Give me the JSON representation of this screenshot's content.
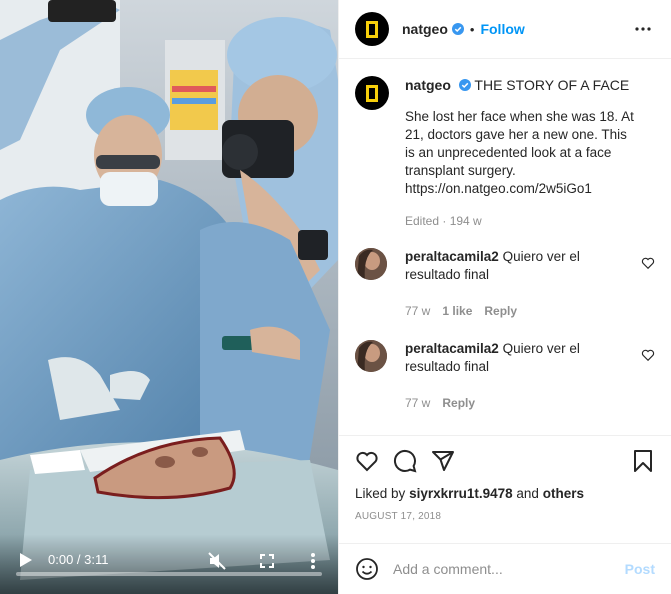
{
  "video": {
    "time": "0:00 / 3:11",
    "progress": 0.0
  },
  "header": {
    "username": "natgeo",
    "separator": "•",
    "follow_label": "Follow"
  },
  "caption": {
    "username": "natgeo",
    "title": "THE STORY OF A FACE",
    "text": "She lost her face when she was 18. At 21, doctors gave her a new one. This is an unprecedented look at a face transplant surgery. https://on.natgeo.com/2w5iGo1",
    "meta": "Edited · 194 w"
  },
  "comments": [
    {
      "username": "peraltacamila2",
      "text": "Quiero ver el resultado final",
      "age": "77 w",
      "likes": "1 like",
      "reply_label": "Reply"
    },
    {
      "username": "peraltacamila2",
      "text": "Quiero ver el resultado final",
      "age": "77 w",
      "reply_label": "Reply"
    }
  ],
  "engagement": {
    "liked_by_prefix": "Liked by",
    "liked_by_user": "siyrxkrru1t.9478",
    "liked_by_and": "and",
    "liked_by_others": "others",
    "date": "AUGUST 17, 2018"
  },
  "add_comment": {
    "placeholder": "Add a comment...",
    "post_label": "Post"
  },
  "colors": {
    "accent": "#0095f6",
    "verified": "#3897f0",
    "post_disabled": "#b3dbff",
    "ng_yellow": "#f7cf0b"
  },
  "icons": [
    "play-icon",
    "mute-icon",
    "fullscreen-icon",
    "more-vertical-icon",
    "verified-icon",
    "more-horizontal-icon",
    "heart-icon",
    "comment-icon",
    "share-icon",
    "save-icon",
    "emoji-icon"
  ]
}
